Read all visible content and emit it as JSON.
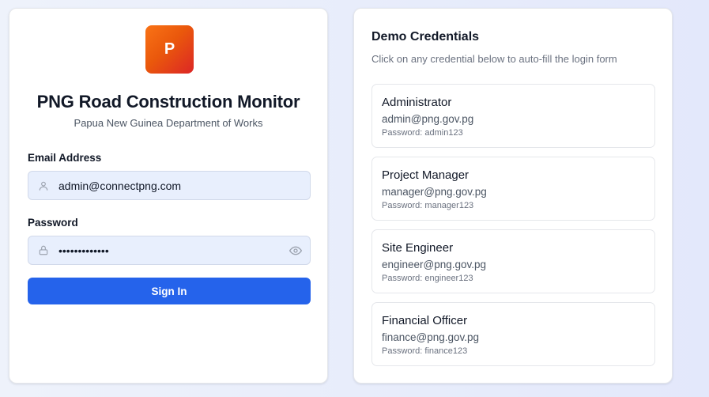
{
  "login": {
    "logo_letter": "P",
    "title": "PNG Road Construction Monitor",
    "subtitle": "Papua New Guinea Department of Works",
    "email_label": "Email Address",
    "email_value": "admin@connectpng.com",
    "password_label": "Password",
    "password_value": "•••••••••••••",
    "signin_label": "Sign In"
  },
  "demo": {
    "title": "Demo Credentials",
    "subtitle": "Click on any credential below to auto-fill the login form",
    "credentials": [
      {
        "role": "Administrator",
        "email": "admin@png.gov.pg",
        "password": "Password: admin123"
      },
      {
        "role": "Project Manager",
        "email": "manager@png.gov.pg",
        "password": "Password: manager123"
      },
      {
        "role": "Site Engineer",
        "email": "engineer@png.gov.pg",
        "password": "Password: engineer123"
      },
      {
        "role": "Financial Officer",
        "email": "finance@png.gov.pg",
        "password": "Password: finance123"
      }
    ]
  },
  "colors": {
    "primary": "#2563eb",
    "logo_gradient_start": "#f97316",
    "logo_gradient_end": "#dc2626",
    "field_bg": "#e8effd"
  },
  "icons": {
    "email_field": "user-icon",
    "password_field": "lock-icon",
    "password_toggle": "eye-icon"
  }
}
